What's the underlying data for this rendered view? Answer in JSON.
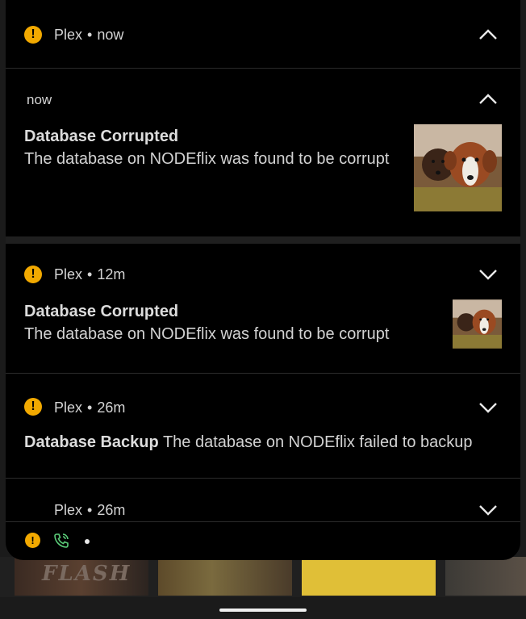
{
  "background": {
    "thumb_text": "FLASH"
  },
  "group": {
    "app": "Plex",
    "time": "now",
    "expanded_time": "now"
  },
  "notifications": [
    {
      "title": "Database Corrupted",
      "text": "The database on NODEflix was found to be corrupt"
    },
    {
      "app": "Plex",
      "time": "12m",
      "title": "Database Corrupted",
      "text": "The database on NODEflix was found to be corrupt"
    },
    {
      "app": "Plex",
      "time": "26m",
      "title": "Database Backup",
      "text": "The database on NODEflix failed to backup"
    },
    {
      "app": "Plex",
      "time": "26m"
    }
  ],
  "separator": "•",
  "colors": {
    "warning": "#f2a900",
    "call": "#5ccf7a"
  },
  "icons": {
    "warning": "warning-icon",
    "call": "wifi-call-icon",
    "expand": "chevron-down-icon",
    "collapse": "chevron-up-icon"
  }
}
